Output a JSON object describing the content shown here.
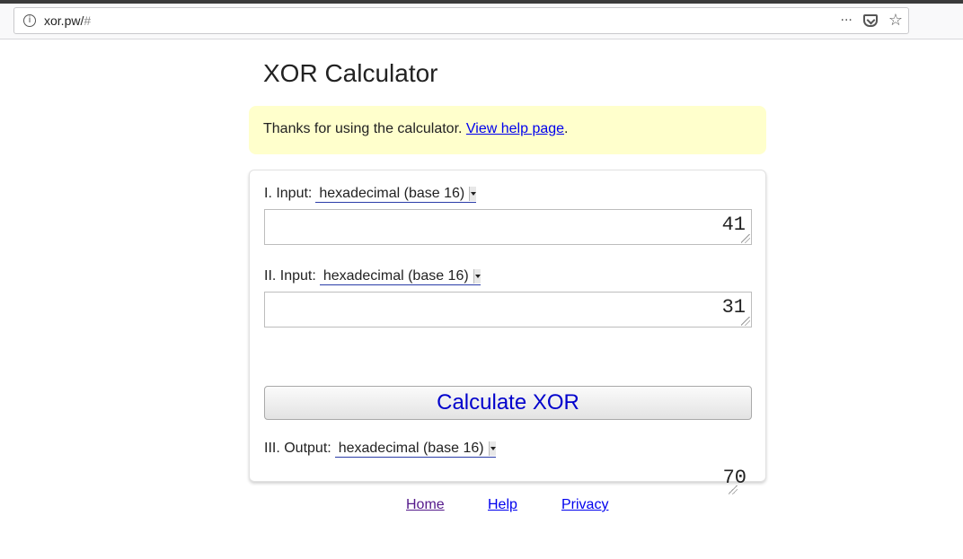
{
  "browser": {
    "url_host": "xor.pw/",
    "url_hash": "#",
    "actions": {
      "more_icon": "···",
      "star_icon": "☆"
    }
  },
  "page": {
    "title": "XOR Calculator",
    "notice": {
      "text": "Thanks for using the calculator. ",
      "link": "View help page",
      "suffix": "."
    },
    "input1": {
      "label": "I. Input:",
      "format": "hexadecimal (base 16)",
      "value": "41"
    },
    "input2": {
      "label": "II. Input:",
      "format": "hexadecimal (base 16)",
      "value": "31"
    },
    "calculate_label": "Calculate XOR",
    "output": {
      "label": "III. Output:",
      "format": "hexadecimal (base 16)",
      "value": "70"
    }
  },
  "footer": {
    "home": "Home",
    "help": "Help",
    "privacy": "Privacy"
  },
  "colors": {
    "notice_bg": "#ffffcc",
    "link": "#0000ee",
    "button_text": "#0000cc"
  }
}
